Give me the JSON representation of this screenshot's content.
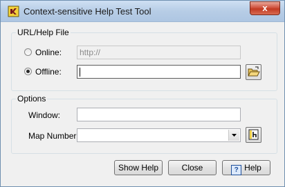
{
  "window": {
    "title": "Context-sensitive Help Test Tool",
    "close_label": "x"
  },
  "url_group": {
    "legend": "URL/Help File",
    "online": {
      "label": "Online:",
      "value": "http://",
      "selected": false
    },
    "offline": {
      "label": "Offline:",
      "value": "",
      "selected": true
    }
  },
  "options_group": {
    "legend": "Options",
    "window_label": "Window:",
    "window_value": "",
    "map_number_label": "Map Number:",
    "map_number_value": ""
  },
  "buttons": {
    "show_help": "Show Help",
    "close": "Close",
    "help": "Help",
    "help_icon_glyph": "?"
  },
  "colors": {
    "titlebar": "#b7cde6",
    "close_button": "#c13a22",
    "window_bg": "#f0f0f0"
  }
}
